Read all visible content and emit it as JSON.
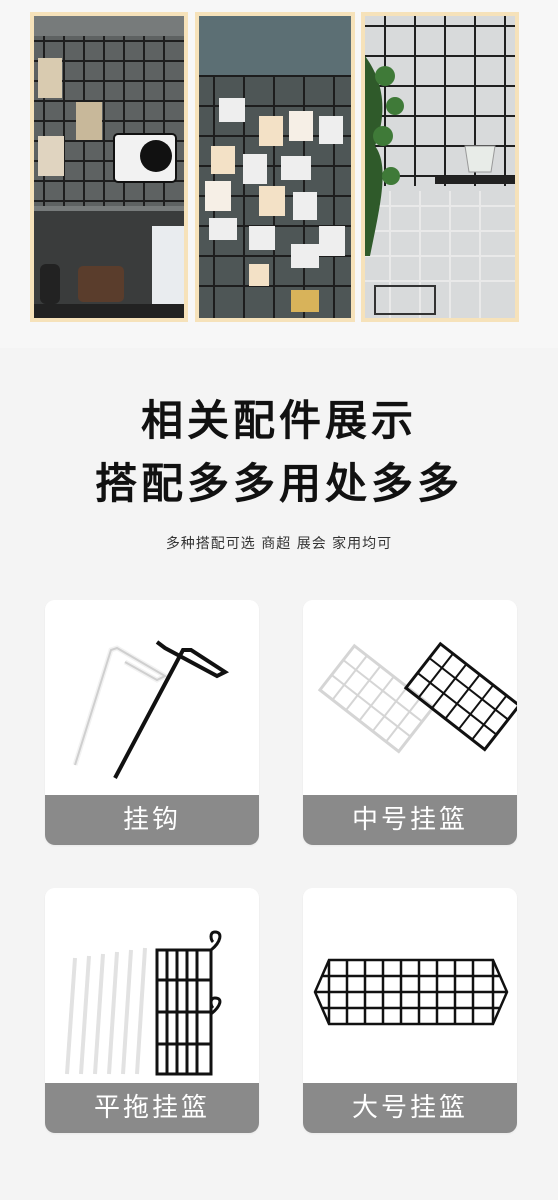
{
  "headings": {
    "line1": "相关配件展示",
    "line2": "搭配多多用处多多",
    "subtitle": "多种搭配可选 商超 展会 家用均可"
  },
  "products": [
    {
      "label": "挂钩"
    },
    {
      "label": "中号挂篮"
    },
    {
      "label": "平拖挂篮"
    },
    {
      "label": "大号挂篮"
    }
  ]
}
